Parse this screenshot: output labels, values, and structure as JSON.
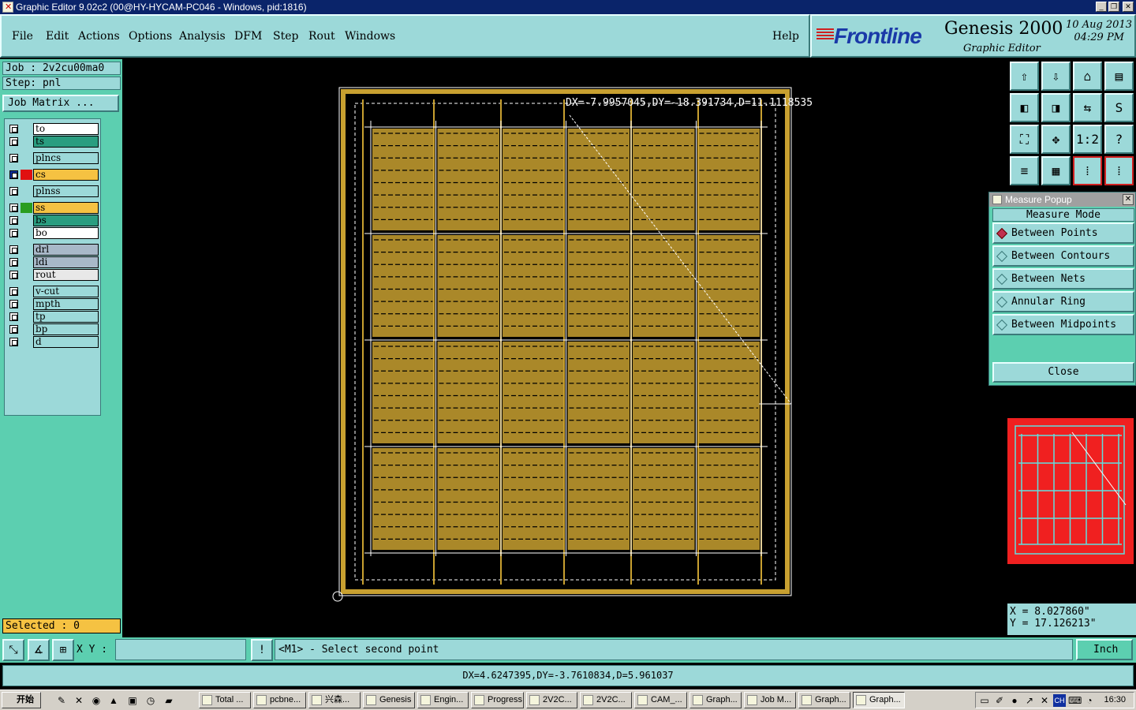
{
  "window": {
    "title": "Graphic Editor 9.02c2 (00@HY-HYCAM-PC046 - Windows, pid:1816)"
  },
  "menu": {
    "items": [
      "File",
      "Edit",
      "Actions",
      "Options",
      "Analysis",
      "DFM",
      "Step",
      "Rout",
      "Windows"
    ],
    "help": "Help"
  },
  "brand": {
    "logo": "Frontline",
    "product": "Genesis 2000",
    "subtitle": "Graphic Editor",
    "date": "10 Aug 2013",
    "time": "04:29 PM"
  },
  "job": {
    "job_label": "Job : 2v2cu00ma0",
    "step_label": "Step: pnl",
    "matrix_button": "Job Matrix ..."
  },
  "layers": [
    {
      "name": "to",
      "color": "#ffffff",
      "swatch": ""
    },
    {
      "name": "ts",
      "color": "#2a9d80",
      "swatch": ""
    },
    {
      "name": "plncs",
      "color": "#9cd9d9",
      "swatch": ""
    },
    {
      "name": "cs",
      "color": "#f5c242",
      "swatch": "#e01010",
      "active": true
    },
    {
      "name": "plnss",
      "color": "#9cd9d9",
      "swatch": ""
    },
    {
      "name": "ss",
      "color": "#f5c242",
      "swatch": "#2a9d20"
    },
    {
      "name": "bs",
      "color": "#2a9d80",
      "swatch": ""
    },
    {
      "name": "bo",
      "color": "#ffffff",
      "swatch": ""
    },
    {
      "name": "drl",
      "color": "#a8b8c8",
      "swatch": ""
    },
    {
      "name": "ldi",
      "color": "#a8b8c8",
      "swatch": ""
    },
    {
      "name": "rout",
      "color": "#e8e8e8",
      "swatch": ""
    },
    {
      "name": "v-cut",
      "color": "#9cd9d9",
      "swatch": ""
    },
    {
      "name": "mpth",
      "color": "#9cd9d9",
      "swatch": ""
    },
    {
      "name": "tp",
      "color": "#9cd9d9",
      "swatch": ""
    },
    {
      "name": "bp",
      "color": "#9cd9d9",
      "swatch": ""
    },
    {
      "name": "d",
      "color": "#9cd9d9",
      "swatch": ""
    }
  ],
  "selected": "Selected : 0",
  "canvas": {
    "measure_readout": "DX=-7.9957045,DY=-18.391734,D=11.1118535",
    "board_color": "#c8a030",
    "panel_bg": "#000000"
  },
  "measure_popup": {
    "title": "Measure Popup",
    "mode_title": "Measure Mode",
    "options": [
      "Between Points",
      "Between Contours",
      "Between Nets",
      "Annular Ring",
      "Between Midpoints"
    ],
    "selected_index": 0,
    "close": "Close"
  },
  "readout": {
    "x": "X = 8.027860\"",
    "y": "Y = 17.126213\""
  },
  "command": {
    "xy_label": "X Y :",
    "xy_value": "",
    "prompt": "<M1> - Select second point",
    "unit": "Inch"
  },
  "status": "DX=4.6247395,DY=-3.7610834,D=5.961037",
  "taskbar": {
    "start": "开始",
    "tasks": [
      "Total ...",
      "pcbne...",
      "兴森...",
      "Genesis",
      "Engin...",
      "Progress",
      "2V2C...",
      "2V2C...",
      "CAM_...",
      "Graph...",
      "Job M...",
      "Graph...",
      "Graph..."
    ],
    "active_index": 12,
    "clock": "16:30"
  }
}
